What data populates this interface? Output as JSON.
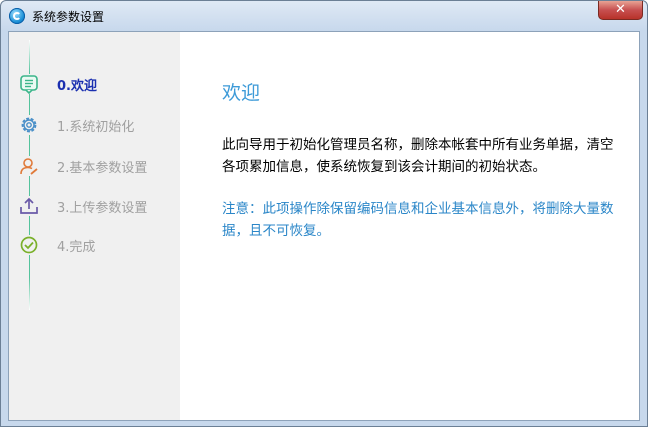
{
  "window": {
    "title": "系统参数设置",
    "close_label": "✕"
  },
  "steps": [
    {
      "label": "0.欢迎",
      "icon": "list-icon",
      "active": true
    },
    {
      "label": "1.系统初始化",
      "icon": "gear-icon",
      "active": false
    },
    {
      "label": "2.基本参数设置",
      "icon": "user-edit-icon",
      "active": false
    },
    {
      "label": "3.上传参数设置",
      "icon": "upload-icon",
      "active": false
    },
    {
      "label": "4.完成",
      "icon": "check-circle-icon",
      "active": false
    }
  ],
  "main": {
    "heading": "欢迎",
    "description": "此向导用于初始化管理员名称，删除本帐套中所有业务单据，清空各项累加信息，使系统恢复到该会计期间的初始状态。",
    "note": "注意：此项操作除保留编码信息和企业基本信息外，将删除大量数据，且不可恢复。"
  },
  "colors": {
    "heading": "#3c9ad8",
    "active_step": "#1a2fb0",
    "inactive_step": "#a0a0a0",
    "note": "#2a86c8",
    "step_line": "#54c39c"
  }
}
